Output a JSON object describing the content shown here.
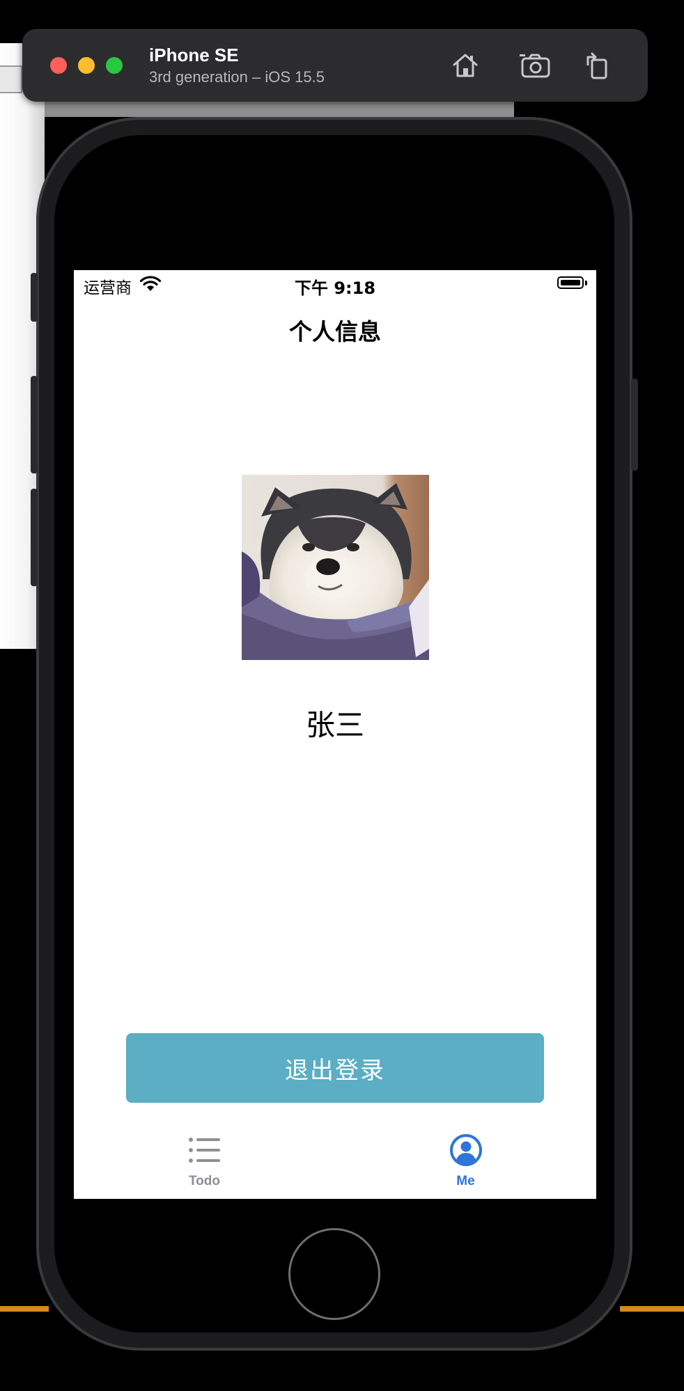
{
  "simulator": {
    "device_name": "iPhone SE",
    "device_detail": "3rd generation – iOS 15.5",
    "buttons": {
      "home": "home-icon",
      "screenshot": "camera-icon",
      "rotate": "rotate-icon"
    }
  },
  "status_bar": {
    "carrier": "运营商",
    "time": "下午 9:18",
    "icons": [
      "wifi-icon",
      "battery-icon"
    ]
  },
  "nav": {
    "title": "个人信息"
  },
  "profile": {
    "avatar_icon": "dog-photo",
    "name": "张三"
  },
  "actions": {
    "logout_label": "退出登录"
  },
  "tab_bar": {
    "items": [
      {
        "label": "Todo",
        "icon": "list-icon",
        "selected": false
      },
      {
        "label": "Me",
        "icon": "person-circle-icon",
        "selected": true
      }
    ]
  },
  "colors": {
    "logout_button": "#5baec3",
    "tab_selected": "#2f74d9",
    "tab_unselected": "#8e8e93"
  }
}
